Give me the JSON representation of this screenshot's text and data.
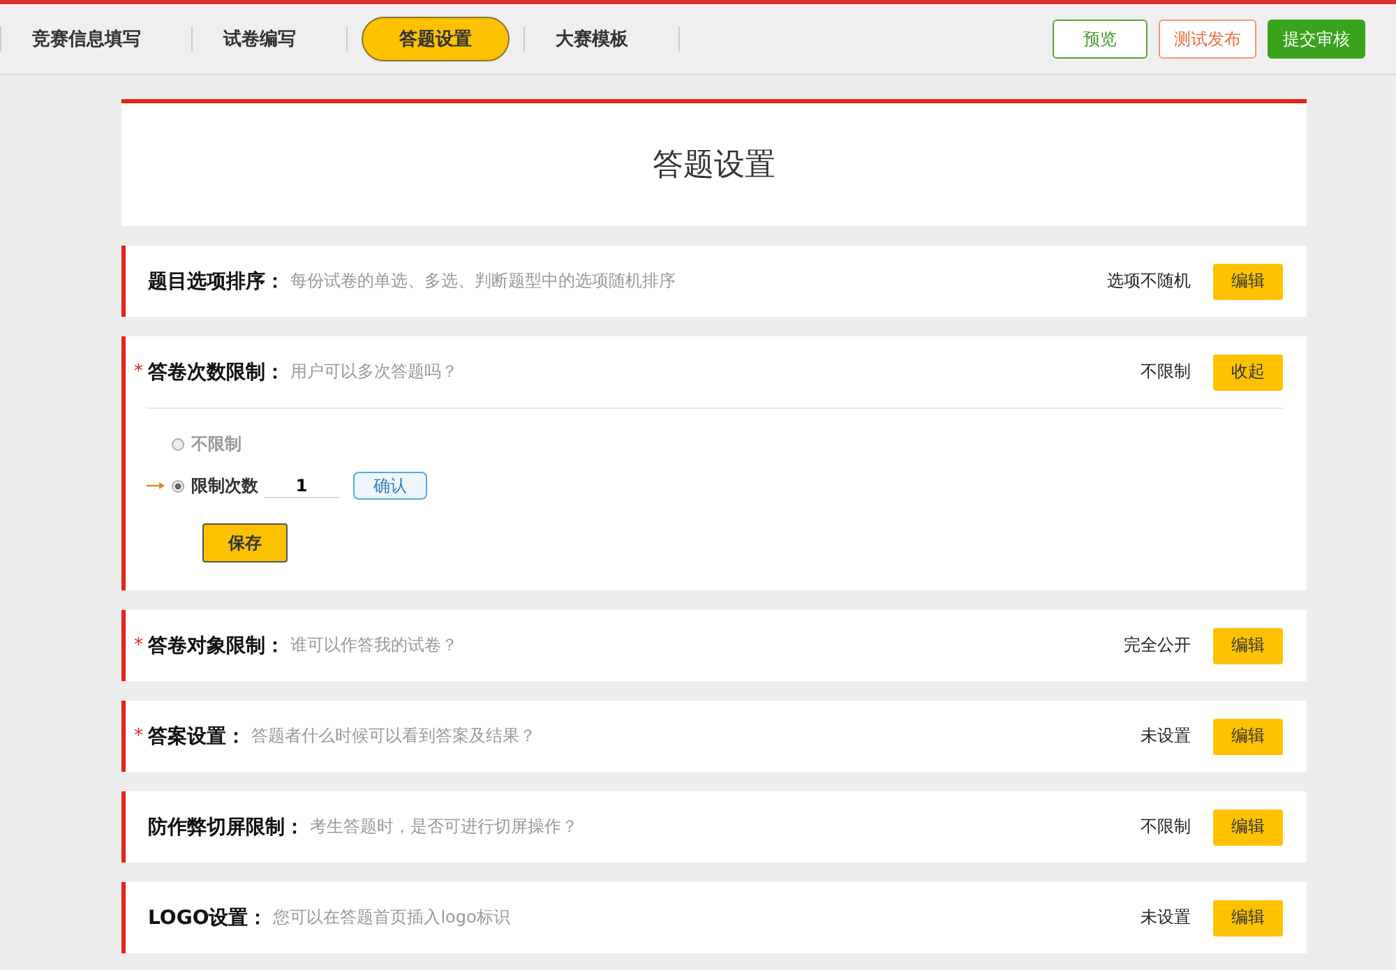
{
  "tabs": [
    {
      "label": "竞赛信息填写",
      "selected": false
    },
    {
      "label": "试卷编写",
      "selected": false
    },
    {
      "label": "答题设置",
      "selected": true
    },
    {
      "label": "大赛模板",
      "selected": false
    }
  ],
  "actions": [
    {
      "label": "预览",
      "kind": "outline-green"
    },
    {
      "label": "测试发布",
      "kind": "outline-orange"
    },
    {
      "label": "提交审核",
      "kind": "solid-green"
    }
  ],
  "page_title": "答题设置",
  "sections": [
    {
      "label": "题目选项排序：",
      "description": "每份试卷的单选、多选、判断题型中的选项随机排序",
      "status": "选项不随机",
      "button": "编辑"
    },
    {
      "mark": "*",
      "label": "答卷次数限制：",
      "description": "用户可以多次答题吗？",
      "status": "不限制",
      "button": "收起",
      "options": [
        {
          "label": "不限制",
          "selected": false
        },
        {
          "label": "限制次数",
          "selected": true,
          "value": "1",
          "confirm": "确认"
        }
      ],
      "save": "保存"
    },
    {
      "mark": "*",
      "label": "答卷对象限制：",
      "description": "谁可以作答我的试卷？",
      "status": "完全公开",
      "button": "编辑"
    },
    {
      "mark": "*",
      "label": "答案设置：",
      "description": "答题者什么时候可以看到答案及结果？",
      "status": "未设置",
      "button": "编辑"
    },
    {
      "label": "防作弊切屏限制：",
      "description": "考生答题时，是否可进行切屏操作？",
      "status": "不限制",
      "button": "编辑"
    },
    {
      "label": "LOGO设置：",
      "description": "您可以在答题首页插入logo标识",
      "status": "未设置",
      "button": "编辑"
    }
  ]
}
